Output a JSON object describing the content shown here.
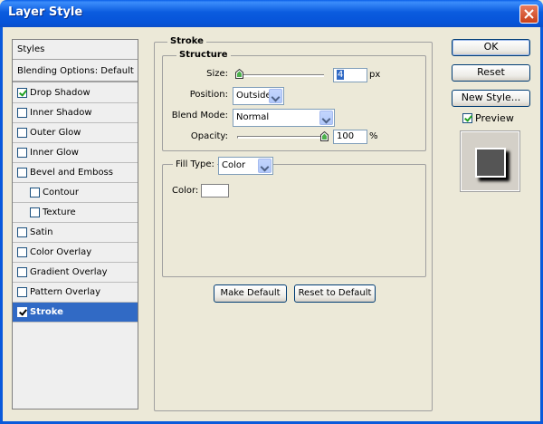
{
  "window": {
    "title": "Layer Style"
  },
  "styles_list": {
    "header": "Styles",
    "blending": "Blending Options: Default",
    "items": [
      {
        "label": "Drop Shadow",
        "checked": true,
        "indent": false
      },
      {
        "label": "Inner Shadow",
        "checked": false,
        "indent": false
      },
      {
        "label": "Outer Glow",
        "checked": false,
        "indent": false
      },
      {
        "label": "Inner Glow",
        "checked": false,
        "indent": false
      },
      {
        "label": "Bevel and Emboss",
        "checked": false,
        "indent": false
      },
      {
        "label": "Contour",
        "checked": false,
        "indent": true
      },
      {
        "label": "Texture",
        "checked": false,
        "indent": true
      },
      {
        "label": "Satin",
        "checked": false,
        "indent": false
      },
      {
        "label": "Color Overlay",
        "checked": false,
        "indent": false
      },
      {
        "label": "Gradient Overlay",
        "checked": false,
        "indent": false
      },
      {
        "label": "Pattern Overlay",
        "checked": false,
        "indent": false
      },
      {
        "label": "Stroke",
        "checked": true,
        "indent": false,
        "selected": true
      }
    ]
  },
  "stroke": {
    "group_title": "Stroke",
    "structure_title": "Structure",
    "size_label": "Size:",
    "size_value": "4",
    "size_unit": "px",
    "size_slider_fraction": 0.02,
    "position_label": "Position:",
    "position_value": "Outside",
    "blend_mode_label": "Blend Mode:",
    "blend_mode_value": "Normal",
    "opacity_label": "Opacity:",
    "opacity_value": "100",
    "opacity_unit": "%",
    "opacity_slider_fraction": 1.0,
    "fill_type_label": "Fill Type:",
    "fill_type_value": "Color",
    "color_label": "Color:",
    "color_value": "#FFFFFF",
    "make_default": "Make Default",
    "reset_to_default": "Reset to Default"
  },
  "buttons": {
    "ok": "OK",
    "reset": "Reset",
    "new_style": "New Style...",
    "preview_label": "Preview",
    "preview_checked": true
  },
  "colors": {
    "title_bar": "#0A5FE8",
    "selection": "#316AC5",
    "preview_fill": "#555555"
  }
}
